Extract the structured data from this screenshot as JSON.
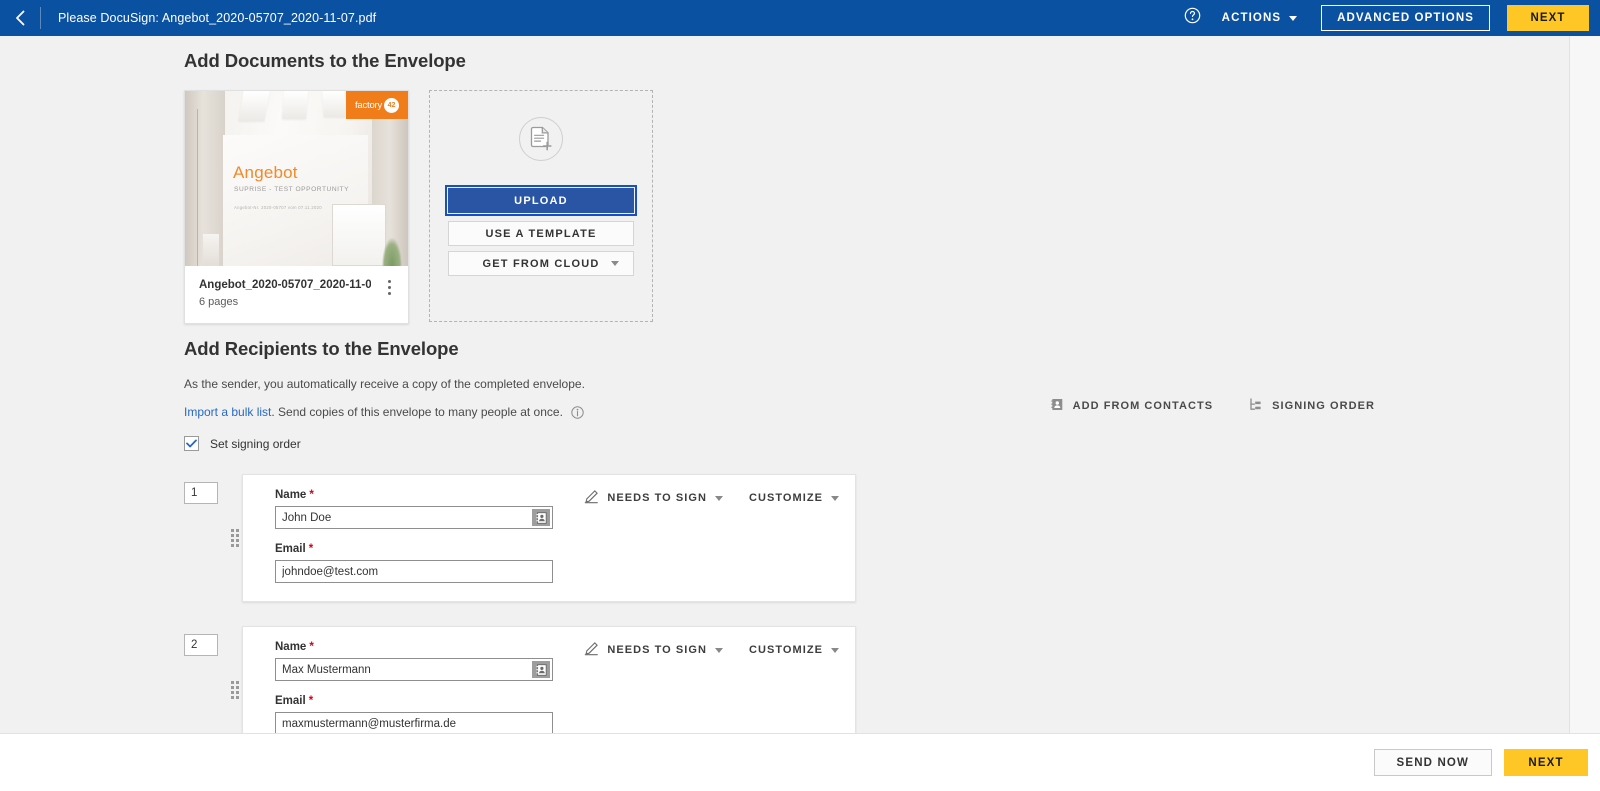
{
  "header": {
    "back_icon": "chevron-left-icon",
    "envelope_title": "Please DocuSign: Angebot_2020-05707_2020-11-07.pdf",
    "help_icon": "help-circle-icon",
    "actions_label": "ACTIONS",
    "advanced_options_label": "ADVANCED OPTIONS",
    "next_label": "NEXT",
    "bg_color": "#0b51a1",
    "next_color": "#ffc726"
  },
  "documents": {
    "section_title": "Add Documents to the Envelope",
    "card": {
      "thumbnail": {
        "doc_heading": "Angebot",
        "doc_subheading": "SUPRISE - TEST OPPORTUNITY",
        "doc_meta": "Angebot-Nr. 2020-05707 vom 07.11.2020",
        "logo_word": "factory",
        "logo_mark": "42",
        "logo_color": "#f07d1a"
      },
      "file_name": "Angebot_2020-05707_2020-11-0...",
      "page_count": "6 pages",
      "menu_icon": "kebab-menu-icon"
    },
    "dropzone": {
      "icon": "document-add-icon",
      "upload_label": "UPLOAD",
      "template_label": "USE A TEMPLATE",
      "cloud_label": "GET FROM CLOUD",
      "upload_color": "#2a55a5"
    }
  },
  "recipients": {
    "section_title": "Add Recipients to the Envelope",
    "sender_note": "As the sender, you automatically receive a copy of the completed envelope.",
    "bulk_link": "Import a bulk list",
    "bulk_rest": ". Send copies of this envelope to many people at once.",
    "bulk_info_icon": "info-circle-icon",
    "signing_order_label": "Set signing order",
    "signing_order_checked": true,
    "actions": [
      {
        "label": "ADD FROM CONTACTS",
        "icon": "contact-card-icon"
      },
      {
        "label": "SIGNING ORDER",
        "icon": "signing-order-icon"
      }
    ],
    "name_label": "Name",
    "email_label": "Email",
    "required_marker": "*",
    "role_label": "NEEDS TO SIGN",
    "role_icon": "pencil-icon",
    "customize_label": "CUSTOMIZE",
    "contact_picker_icon": "address-book-icon",
    "drag_handle_icon": "drag-handle-icon",
    "list": [
      {
        "order": "1",
        "name": "John Doe",
        "email": "johndoe@test.com"
      },
      {
        "order": "2",
        "name": "Max Mustermann",
        "email": "maxmustermann@musterfirma.de"
      }
    ]
  },
  "footer": {
    "send_now_label": "SEND NOW",
    "next_label": "NEXT"
  }
}
